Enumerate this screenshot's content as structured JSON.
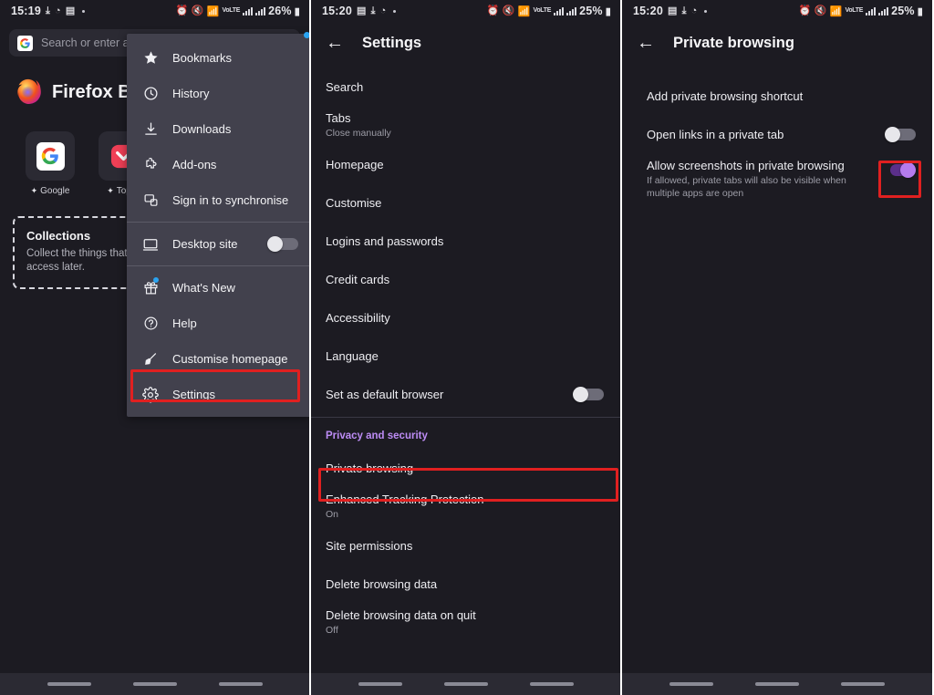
{
  "panel1": {
    "status_bar": {
      "time": "15:19",
      "battery": "26%",
      "icons": [
        "download-icon",
        "clock-icon",
        "image-icon",
        "dot-icon"
      ],
      "right_icons": [
        "alarm-icon",
        "mute-icon",
        "wifi-icon",
        "data-icon",
        "signal-icon",
        "signal-icon"
      ]
    },
    "url_bar": {
      "placeholder": "Search or enter add",
      "engine": "G"
    },
    "brand": "Firefox Br",
    "shortcuts": [
      {
        "label": "Google",
        "glyph": "G"
      },
      {
        "label": "Top A",
        "glyph": "v"
      }
    ],
    "collections": {
      "title": "Collections",
      "body": "Collect the things that m Group together similar s access later."
    },
    "menu": {
      "items": [
        {
          "label": "Bookmarks",
          "icon": "star-icon",
          "type": "item"
        },
        {
          "label": "History",
          "icon": "clock-icon",
          "type": "item"
        },
        {
          "label": "Downloads",
          "icon": "download-icon",
          "type": "item"
        },
        {
          "label": "Add-ons",
          "icon": "puzzle-icon",
          "type": "item"
        },
        {
          "label": "Sign in to synchronise",
          "icon": "sync-icon",
          "type": "item"
        },
        {
          "label": "Desktop site",
          "icon": "desktop-icon",
          "type": "toggle",
          "toggle_on": false
        },
        {
          "label": "What's New",
          "icon": "gift-icon",
          "type": "item",
          "badge": true
        },
        {
          "label": "Help",
          "icon": "help-icon",
          "type": "item"
        },
        {
          "label": "Customise homepage",
          "icon": "brush-icon",
          "type": "item"
        },
        {
          "label": "Settings",
          "icon": "gear-icon",
          "type": "item",
          "highlighted": true
        }
      ]
    }
  },
  "panel2": {
    "status_bar": {
      "time": "15:20",
      "battery": "25%"
    },
    "header": {
      "title": "Settings",
      "back": "back-arrow-icon"
    },
    "items": [
      {
        "title": "Search"
      },
      {
        "title": "Tabs",
        "subtitle": "Close manually"
      },
      {
        "title": "Homepage"
      },
      {
        "title": "Customise"
      },
      {
        "title": "Logins and passwords"
      },
      {
        "title": "Credit cards"
      },
      {
        "title": "Accessibility"
      },
      {
        "title": "Language"
      },
      {
        "title": "Set as default browser",
        "toggle": true,
        "toggle_on": false
      }
    ],
    "section_header": "Privacy and security",
    "privacy_items": [
      {
        "title": "Private browsing",
        "highlighted": true
      },
      {
        "title": "Enhanced Tracking Protection",
        "subtitle": "On"
      },
      {
        "title": "Site permissions"
      },
      {
        "title": "Delete browsing data"
      },
      {
        "title": "Delete browsing data on quit",
        "subtitle": "Off"
      }
    ]
  },
  "panel3": {
    "status_bar": {
      "time": "15:20",
      "battery": "25%"
    },
    "header": {
      "title": "Private browsing",
      "back": "back-arrow-icon"
    },
    "items": [
      {
        "title": "Add private browsing shortcut"
      },
      {
        "title": "Open links in a private tab",
        "toggle": true,
        "toggle_on": false
      },
      {
        "title": "Allow screenshots in private browsing",
        "subtitle": "If allowed, private tabs will also be visible when multiple apps are open",
        "toggle": true,
        "toggle_on": true,
        "highlighted": true
      }
    ]
  },
  "colors": {
    "highlight": "#e02020",
    "accent_purple": "#bd8cf5",
    "toggle_on": "#b57bee",
    "background": "#1c1b22",
    "menu_bg": "#42414d"
  }
}
